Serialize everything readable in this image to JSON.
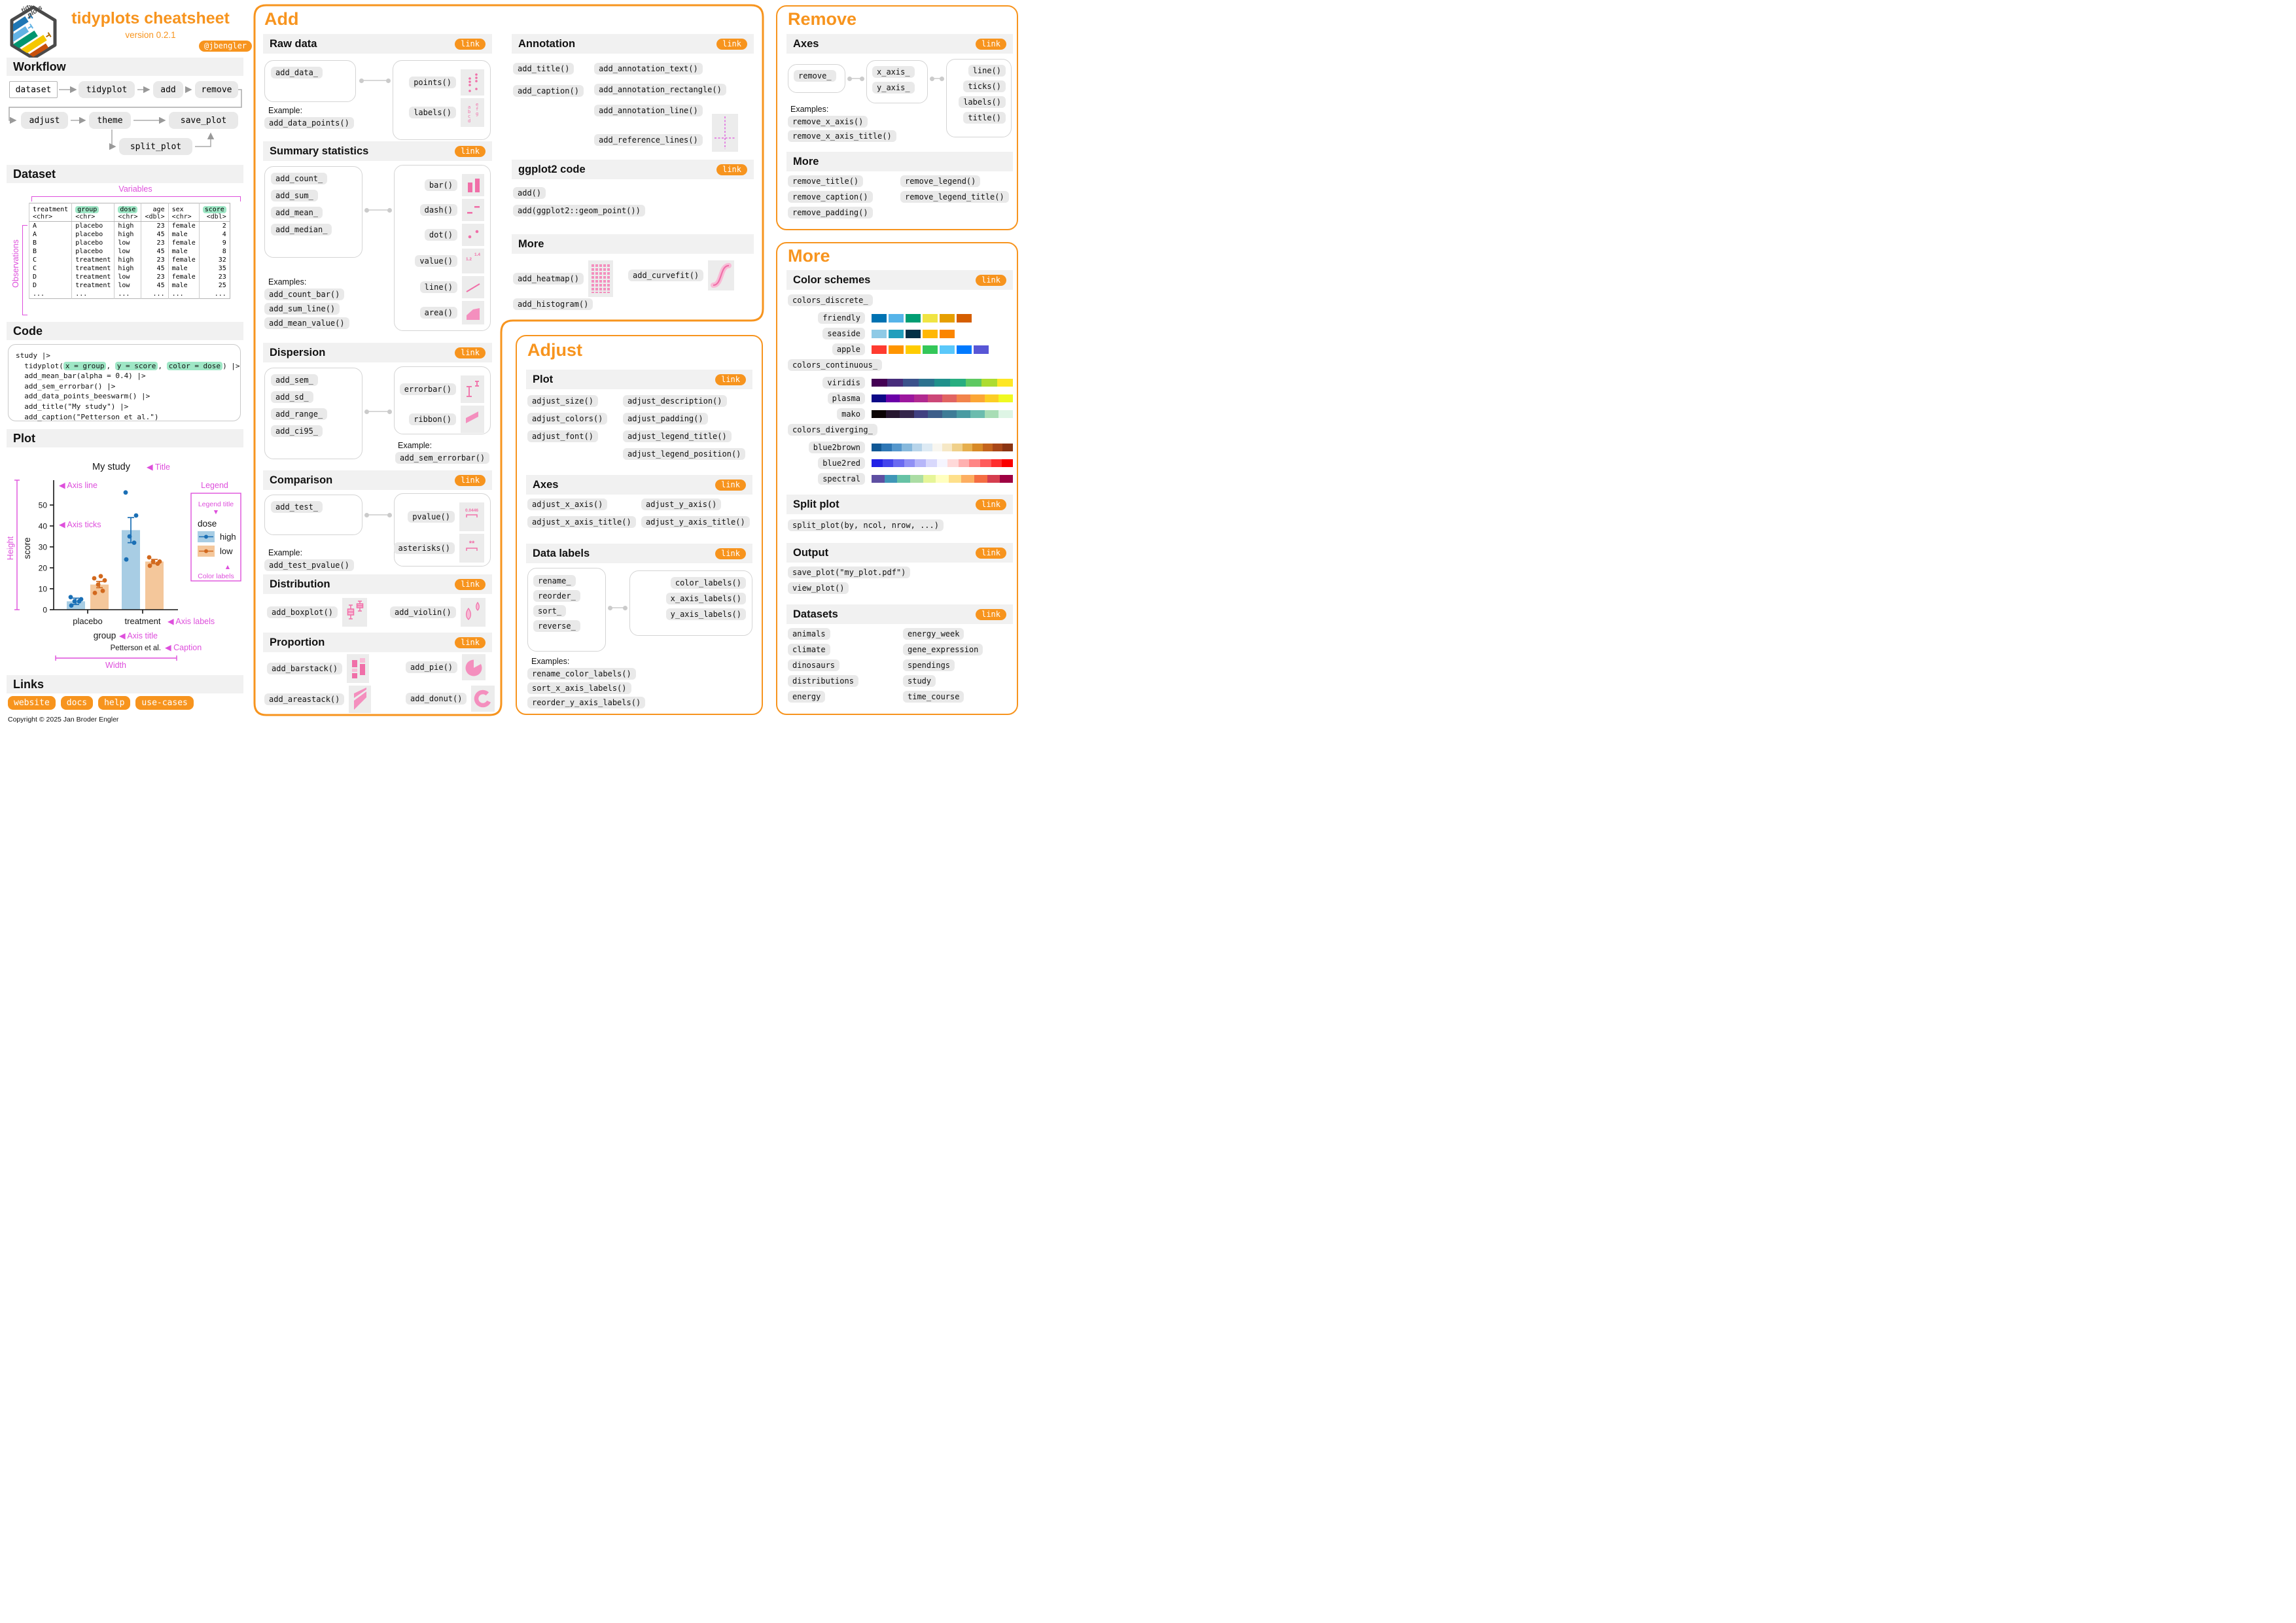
{
  "colors": {
    "accent": "#F7941E",
    "magenta": "#DE4FDC",
    "pink": "#F06FA8",
    "pink_light": "#F8BBD6",
    "green_highlight": "#9FE7C6"
  },
  "header": {
    "title": "tidyplots cheatsheet",
    "version": "version 0.2.1",
    "handle": "@jbengler",
    "logo_word_top": "tidy",
    "logo_word_bottom": "plots"
  },
  "workflow": {
    "title": "Workflow",
    "nodes": [
      "dataset",
      "tidyplot",
      "add",
      "remove",
      "adjust",
      "theme",
      "save_plot",
      "split_plot"
    ]
  },
  "dataset": {
    "title": "Dataset",
    "variables_label": "Variables",
    "observations_label": "Observations",
    "columns": [
      {
        "name": "treatment",
        "type": "<chr>",
        "hl": false,
        "align": "left"
      },
      {
        "name": "group",
        "type": "<chr>",
        "hl": true,
        "align": "left"
      },
      {
        "name": "dose",
        "type": "<chr>",
        "hl": true,
        "align": "left"
      },
      {
        "name": "age",
        "type": "<dbl>",
        "hl": false,
        "align": "right"
      },
      {
        "name": "sex",
        "type": "<chr>",
        "hl": false,
        "align": "left"
      },
      {
        "name": "score",
        "type": "<dbl>",
        "hl": true,
        "align": "right"
      }
    ],
    "rows": [
      [
        "A",
        "placebo",
        "high",
        "23",
        "female",
        "2"
      ],
      [
        "A",
        "placebo",
        "high",
        "45",
        "male",
        "4"
      ],
      [
        "B",
        "placebo",
        "low",
        "23",
        "female",
        "9"
      ],
      [
        "B",
        "placebo",
        "low",
        "45",
        "male",
        "8"
      ],
      [
        "C",
        "treatment",
        "high",
        "23",
        "female",
        "32"
      ],
      [
        "C",
        "treatment",
        "high",
        "45",
        "male",
        "35"
      ],
      [
        "D",
        "treatment",
        "low",
        "23",
        "female",
        "23"
      ],
      [
        "D",
        "treatment",
        "low",
        "45",
        "male",
        "25"
      ],
      [
        "...",
        "...",
        "...",
        "...",
        "...",
        "..."
      ]
    ]
  },
  "code": {
    "title": "Code",
    "lines": [
      [
        {
          "t": "study |>"
        }
      ],
      [
        {
          "t": "  tidyplot("
        },
        {
          "t": "x = group",
          "h": true
        },
        {
          "t": ", "
        },
        {
          "t": "y = score",
          "h": true
        },
        {
          "t": ", "
        },
        {
          "t": "color = dose",
          "h": true
        },
        {
          "t": ") |>"
        }
      ],
      [
        {
          "t": "  add_mean_bar(alpha = 0.4) |>"
        }
      ],
      [
        {
          "t": "  add_sem_errorbar() |>"
        }
      ],
      [
        {
          "t": "  add_data_points_beeswarm() |>"
        }
      ],
      [
        {
          "t": "  add_title(\"My study\") |>"
        }
      ],
      [
        {
          "t": "  add_caption(\"Petterson et al.\")"
        }
      ]
    ]
  },
  "plot": {
    "title": "Plot",
    "annotations": {
      "title_note": "Title",
      "axis_line": "Axis line",
      "axis_ticks": "Axis ticks",
      "height": "Height",
      "legend": "Legend",
      "legend_title": "Legend title",
      "color_labels": "Color labels",
      "axis_labels": "Axis labels",
      "axis_title": "Axis title",
      "caption_note": "Caption",
      "width": "Width"
    }
  },
  "chart_data": {
    "type": "bar",
    "title": "My study",
    "xlabel": "group",
    "ylabel": "score",
    "caption": "Petterson et al.",
    "legend_title": "dose",
    "legend_position": "right",
    "grid": false,
    "categories": [
      "placebo",
      "treatment"
    ],
    "yticks": [
      0,
      10,
      20,
      30,
      40,
      50
    ],
    "ylim": [
      0,
      57
    ],
    "series": [
      {
        "name": "high",
        "bar_color": "#A8CDE4",
        "point_color": "#1A6FB5",
        "means": [
          4,
          38
        ],
        "sem": [
          1.5,
          6
        ],
        "points": [
          [
            2,
            4,
            4,
            5,
            6
          ],
          [
            24,
            32,
            35,
            45,
            56
          ]
        ]
      },
      {
        "name": "low",
        "bar_color": "#F4C79B",
        "point_color": "#D2691E",
        "means": [
          12,
          23
        ],
        "sem": [
          1.5,
          1
        ],
        "points": [
          [
            8,
            9,
            12,
            14,
            15,
            16
          ],
          [
            21,
            22,
            23,
            23,
            25
          ]
        ]
      }
    ]
  },
  "links": {
    "title": "Links",
    "items": [
      "website",
      "docs",
      "help",
      "use-cases"
    ],
    "copyright": "Copyright © 2025 Jan Broder Engler"
  },
  "add_panel": {
    "title": "Add",
    "raw_data": {
      "label": "Raw data",
      "link": "link",
      "source": [
        "add_data_"
      ],
      "targets": [
        {
          "label": "points()"
        },
        {
          "label": "labels()"
        }
      ],
      "example_label": "Example:",
      "examples": [
        "add_data_points()"
      ]
    },
    "summary": {
      "label": "Summary statistics",
      "link": "link",
      "source": [
        "add_count_",
        "add_sum_",
        "add_mean_",
        "add_median_"
      ],
      "targets": [
        {
          "label": "bar()"
        },
        {
          "label": "dash()"
        },
        {
          "label": "dot()"
        },
        {
          "label": "value()"
        },
        {
          "label": "line()"
        },
        {
          "label": "area()"
        }
      ],
      "example_label": "Examples:",
      "examples": [
        "add_count_bar()",
        "add_sum_line()",
        "add_mean_value()"
      ]
    },
    "dispersion": {
      "label": "Dispersion",
      "link": "link",
      "source": [
        "add_sem_",
        "add_sd_",
        "add_range_",
        "add_ci95_"
      ],
      "targets": [
        {
          "label": "errorbar()"
        },
        {
          "label": "ribbon()"
        }
      ],
      "example_label": "Example:",
      "examples": [
        "add_sem_errorbar()"
      ]
    },
    "comparison": {
      "label": "Comparison",
      "link": "link",
      "source": [
        "add_test_"
      ],
      "targets": [
        {
          "label": "pvalue()"
        },
        {
          "label": "asterisks()"
        }
      ],
      "example_label": "Example:",
      "examples": [
        "add_test_pvalue()"
      ]
    },
    "distribution": {
      "label": "Distribution",
      "link": "link",
      "items": [
        {
          "label": "add_boxplot()"
        },
        {
          "label": "add_violin()"
        }
      ]
    },
    "proportion": {
      "label": "Proportion",
      "link": "link",
      "items": [
        {
          "label": "add_barstack()"
        },
        {
          "label": "add_pie()"
        },
        {
          "label": "add_areastack()"
        },
        {
          "label": "add_donut()"
        }
      ]
    },
    "annotation": {
      "label": "Annotation",
      "link": "link",
      "col1": [
        "add_title()",
        "add_caption()"
      ],
      "col2": [
        "add_annotation_text()",
        "add_annotation_rectangle()",
        "add_annotation_line()"
      ],
      "ref_item": "add_reference_lines()"
    },
    "ggplot2": {
      "label": "ggplot2 code",
      "link": "link",
      "items": [
        "add()",
        "add(ggplot2::geom_point())"
      ]
    },
    "more": {
      "label": "More",
      "heatmap": "add_heatmap()",
      "curvefit": "add_curvefit()",
      "histogram": "add_histogram()"
    },
    "icons": {
      "value_lo": "1.2",
      "value_hi": "1.4",
      "pvalue": "0.0446",
      "asterisks": "**",
      "l1": "a",
      "l2": "b",
      "l3": "c",
      "l4": "d",
      "l5": "e",
      "l6": "f",
      "l7": "g"
    }
  },
  "adjust_panel": {
    "title": "Adjust",
    "plot": {
      "label": "Plot",
      "link": "link",
      "col1": [
        "adjust_size()",
        "adjust_colors()",
        "adjust_font()"
      ],
      "col2": [
        "adjust_description()",
        "adjust_padding()",
        "adjust_legend_title()",
        "adjust_legend_position()"
      ]
    },
    "axes": {
      "label": "Axes",
      "link": "link",
      "col1": [
        "adjust_x_axis()",
        "adjust_x_axis_title()"
      ],
      "col2": [
        "adjust_y_axis()",
        "adjust_y_axis_title()"
      ]
    },
    "data_labels": {
      "label": "Data labels",
      "link": "link",
      "source": [
        "rename_",
        "reorder_",
        "sort_",
        "reverse_"
      ],
      "targets": [
        "color_labels()",
        "x_axis_labels()",
        "y_axis_labels()"
      ],
      "example_label": "Examples:",
      "examples": [
        "rename_color_labels()",
        "sort_x_axis_labels()",
        "reorder_y_axis_labels()"
      ]
    }
  },
  "remove_panel": {
    "title": "Remove",
    "axes": {
      "label": "Axes",
      "link": "link",
      "source": [
        "remove_"
      ],
      "mid": [
        "x_axis_",
        "y_axis_"
      ],
      "targets": [
        "line()",
        "ticks()",
        "labels()",
        "title()"
      ],
      "example_label": "Examples:",
      "examples": [
        "remove_x_axis()",
        "remove_x_axis_title()"
      ]
    },
    "more": {
      "label": "More",
      "col1": [
        "remove_title()",
        "remove_caption()",
        "remove_padding()"
      ],
      "col2": [
        "remove_legend()",
        "remove_legend_title()"
      ]
    }
  },
  "more_panel": {
    "title": "More",
    "color_schemes": {
      "label": "Color schemes",
      "link": "link",
      "discrete_label": "colors_discrete_",
      "discrete": [
        {
          "name": "friendly",
          "colors": [
            "#0072B2",
            "#56B4E9",
            "#009E73",
            "#F0E442",
            "#E69F00",
            "#D55E00"
          ]
        },
        {
          "name": "seaside",
          "colors": [
            "#8ECAE6",
            "#219EBC",
            "#023047",
            "#FFB703",
            "#FB8500"
          ]
        },
        {
          "name": "apple",
          "colors": [
            "#FF3B30",
            "#FF9500",
            "#FFCC00",
            "#34C759",
            "#5AC8FA",
            "#007AFF",
            "#5856D6"
          ]
        }
      ],
      "continuous_label": "colors_continuous_",
      "continuous": [
        {
          "name": "viridis",
          "colors": [
            "#440154",
            "#472D7B",
            "#3B528B",
            "#2C728E",
            "#21918C",
            "#28AE80",
            "#5EC962",
            "#ADDC30",
            "#FDE725"
          ]
        },
        {
          "name": "plasma",
          "colors": [
            "#0D0887",
            "#6A00A8",
            "#9C179E",
            "#B12A90",
            "#CC4778",
            "#E16462",
            "#F2844B",
            "#FCA636",
            "#FCCE25",
            "#F0F921"
          ]
        },
        {
          "name": "mako",
          "colors": [
            "#0B0405",
            "#26172F",
            "#35264C",
            "#414081",
            "#3D5E8A",
            "#3E7C97",
            "#499BA2",
            "#6BBCAE",
            "#A8DDB5",
            "#DEF5E5"
          ]
        }
      ],
      "diverging_label": "colors_diverging_",
      "diverging": [
        {
          "name": "blue2brown",
          "colors": [
            "#105895",
            "#2E77B5",
            "#5597CC",
            "#86B8DC",
            "#B7D4EA",
            "#DDEAF4",
            "#F8F6F0",
            "#F6E8C6",
            "#F0D08A",
            "#E6AF4E",
            "#D88A27",
            "#C4641D",
            "#A84718",
            "#8A3412"
          ]
        },
        {
          "name": "blue2red",
          "colors": [
            "#2222E6",
            "#4444EC",
            "#6A6AF1",
            "#9090F5",
            "#B6B6F9",
            "#D8D8FC",
            "#F5F5FF",
            "#FFD9D9",
            "#FFB0B0",
            "#FF8585",
            "#FF5A5A",
            "#FF2E2E",
            "#FA0000"
          ]
        },
        {
          "name": "spectral",
          "colors": [
            "#5E4FA2",
            "#3F96B7",
            "#66C2A5",
            "#ABDDA4",
            "#E6F598",
            "#FFFFBF",
            "#FEE08B",
            "#FDAE61",
            "#F46D43",
            "#D53E4F",
            "#9E0142"
          ]
        }
      ]
    },
    "split_plot": {
      "label": "Split plot",
      "link": "link",
      "items": [
        "split_plot(by, ncol, nrow, ...)"
      ]
    },
    "output": {
      "label": "Output",
      "link": "link",
      "items": [
        "save_plot(\"my_plot.pdf\")",
        "view_plot()"
      ]
    },
    "datasets": {
      "label": "Datasets",
      "link": "link",
      "col1": [
        "animals",
        "climate",
        "dinosaurs",
        "distributions",
        "energy"
      ],
      "col2": [
        "energy_week",
        "gene_expression",
        "spendings",
        "study",
        "time_course"
      ]
    }
  }
}
